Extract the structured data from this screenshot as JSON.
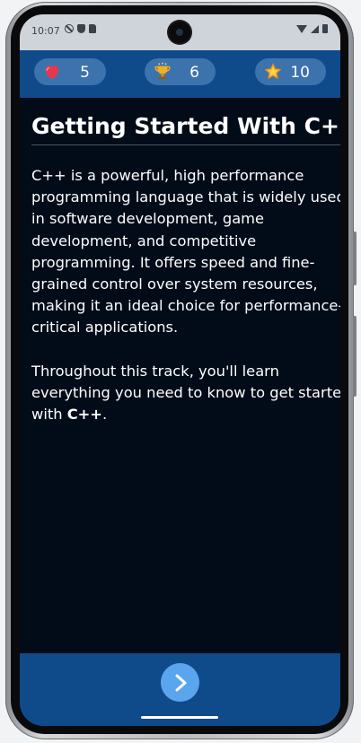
{
  "status": {
    "time": "10:07"
  },
  "header": {
    "lives": {
      "icon": "heart-icon",
      "count": "5"
    },
    "trophies": {
      "icon": "trophy-icon",
      "count": "6"
    },
    "stars": {
      "icon": "star-icon",
      "count": "10"
    }
  },
  "lesson": {
    "title": "Getting Started With C++",
    "paragraph1": "C++ is a powerful, high performance programming language that is widely used in software development, game development, and competitive programming. It offers speed and fine-grained control over system resources, making it an ideal choice for performance-critical applications.",
    "paragraph2_prefix": "Throughout this track, you'll learn everything you need to know to get started with ",
    "paragraph2_emphasis": "C++",
    "paragraph2_suffix": "."
  },
  "footer": {
    "next_icon": "chevron-right-icon"
  },
  "colors": {
    "header_bg": "#0f4a8a",
    "pill_bg": "#3d73ad",
    "screen_bg": "#010c18",
    "next_button": "#5aa6ee"
  }
}
